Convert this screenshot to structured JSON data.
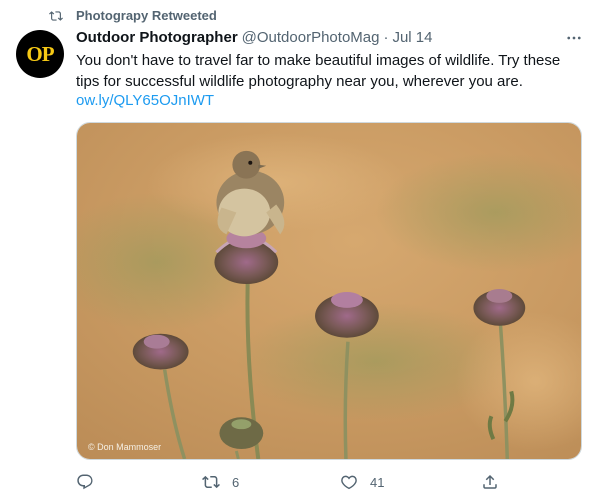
{
  "retweet_context": {
    "label": "Photograpy Retweeted"
  },
  "author": {
    "avatar_text": "OP",
    "name": "Outdoor Photographer",
    "handle": "@OutdoorPhotoMag",
    "separator": "·",
    "date": "Jul 14"
  },
  "tweet": {
    "text": "You don't have to travel far to make beautiful images of wildlife. Try these tips for successful wildlife photography near you, wherever you are.",
    "link": "ow.ly/QLY65OJnIWT"
  },
  "media": {
    "credit": "© Don Mammoser"
  },
  "actions": {
    "reply_count": "",
    "retweet_count": "6",
    "like_count": "41"
  },
  "colors": {
    "text_secondary": "#536471",
    "link": "#1d9bf0",
    "avatar_bg": "#000000",
    "avatar_text": "#f6c915"
  }
}
